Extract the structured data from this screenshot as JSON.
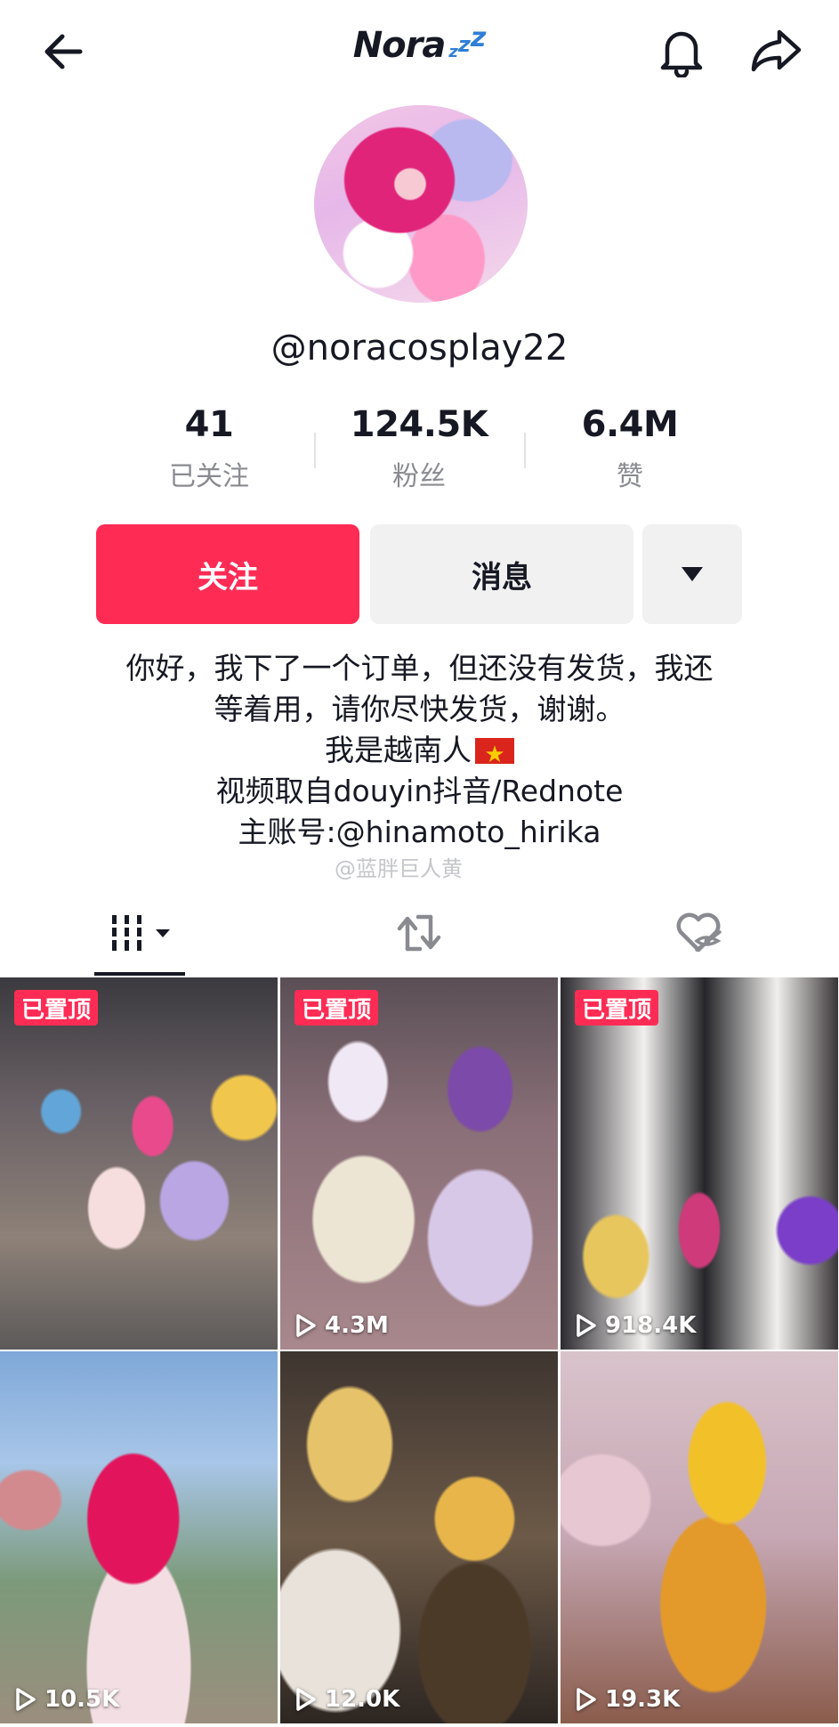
{
  "header": {
    "title": "Nora",
    "title_badge": "zzz",
    "back_icon": "arrow-left-icon",
    "bell_icon": "bell-icon",
    "share_icon": "share-arrow-icon"
  },
  "profile": {
    "username": "@noracosplay22",
    "avatar": "avatar"
  },
  "stats": [
    {
      "value": "41",
      "label": "已关注"
    },
    {
      "value": "124.5K",
      "label": "粉丝"
    },
    {
      "value": "6.4M",
      "label": "赞"
    }
  ],
  "actions": {
    "follow_label": "关注",
    "message_label": "消息",
    "more_icon": "triangle-down-icon"
  },
  "bio": {
    "line1": "你好，我下了一个订单，但还没有发货，我还",
    "line2": "等着用，请你尽快发货，谢谢。",
    "line3": "我是越南人",
    "line4": "视频取自douyin抖音/Rednote",
    "line5": "主账号:@hinamoto_hirika"
  },
  "watermark": "@蓝胖巨人黄",
  "tabs": [
    {
      "name": "videos",
      "icon": "grid-bars-icon",
      "active": true
    },
    {
      "name": "reposts",
      "icon": "repost-icon"
    },
    {
      "name": "liked",
      "icon": "hidden-heart-icon"
    }
  ],
  "videos": [
    {
      "pinned": true,
      "pin_label": "已置顶",
      "views": ""
    },
    {
      "pinned": true,
      "pin_label": "已置顶",
      "views": "4.3M"
    },
    {
      "pinned": true,
      "pin_label": "已置顶",
      "views": "918.4K"
    },
    {
      "pinned": false,
      "views": "10.5K"
    },
    {
      "pinned": false,
      "views": "12.0K"
    },
    {
      "pinned": false,
      "views": "19.3K"
    }
  ],
  "colors": {
    "accent": "#fe2c55",
    "text": "#161823",
    "muted": "#8a8b91",
    "button_bg": "#f1f1f2",
    "title_badge": "#2f7fd6"
  }
}
